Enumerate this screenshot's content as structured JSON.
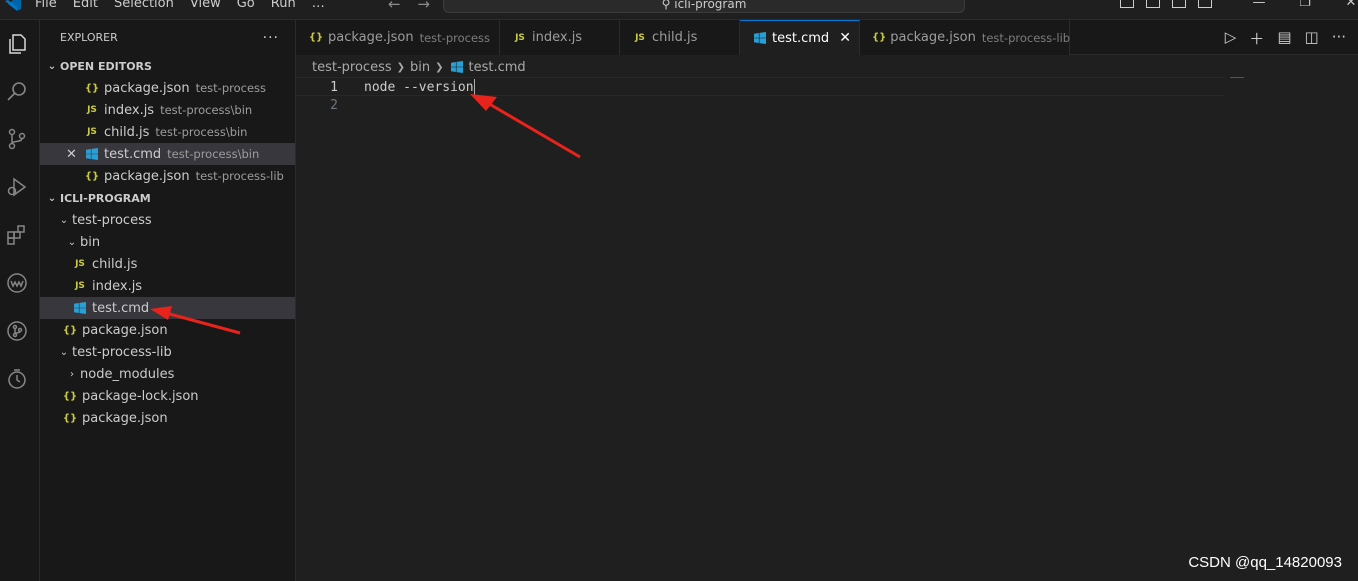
{
  "titlebar": {
    "menu": [
      "File",
      "Edit",
      "Selection",
      "View",
      "Go",
      "Run",
      "…"
    ],
    "search_text": "icli-program"
  },
  "explorer": {
    "title": "EXPLORER",
    "more": "···",
    "open_editors_label": "OPEN EDITORS",
    "open_editors": [
      {
        "name": "package.json",
        "desc": "test-process",
        "type": "json"
      },
      {
        "name": "index.js",
        "desc": "test-process\\bin",
        "type": "js"
      },
      {
        "name": "child.js",
        "desc": "test-process\\bin",
        "type": "js"
      },
      {
        "name": "test.cmd",
        "desc": "test-process\\bin",
        "type": "cmd"
      },
      {
        "name": "package.json",
        "desc": "test-process-lib",
        "type": "json"
      }
    ],
    "folder_label": "ICLI-PROGRAM",
    "tree": [
      {
        "name": "test-process",
        "kind": "folder"
      },
      {
        "name": "bin",
        "kind": "folder"
      },
      {
        "name": "child.js",
        "kind": "js"
      },
      {
        "name": "index.js",
        "kind": "js"
      },
      {
        "name": "test.cmd",
        "kind": "cmd"
      },
      {
        "name": "package.json",
        "kind": "json"
      },
      {
        "name": "test-process-lib",
        "kind": "folder"
      },
      {
        "name": "node_modules",
        "kind": "folder-collapsed"
      },
      {
        "name": "package-lock.json",
        "kind": "json"
      },
      {
        "name": "package.json",
        "kind": "json"
      }
    ]
  },
  "tabs": [
    {
      "name": "package.json",
      "desc": "test-process"
    },
    {
      "name": "index.js",
      "desc": ""
    },
    {
      "name": "child.js",
      "desc": ""
    },
    {
      "name": "test.cmd",
      "desc": "",
      "active": true
    },
    {
      "name": "package.json",
      "desc": "test-process-lib"
    }
  ],
  "breadcrumb": [
    "test-process",
    "bin",
    "test.cmd"
  ],
  "editor": {
    "lines": [
      {
        "num": "1",
        "text": "node --version"
      },
      {
        "num": "2",
        "text": ""
      }
    ]
  },
  "icons": {
    "json": "{}",
    "js": "JS",
    "close": "✕"
  },
  "colors": {
    "annotation_arrow": "#e8231b",
    "accent": "#0078d4",
    "cmd_icon": "#2a9fd6",
    "json_icon": "#cbcb41"
  },
  "watermark": "CSDN @qq_14820093"
}
